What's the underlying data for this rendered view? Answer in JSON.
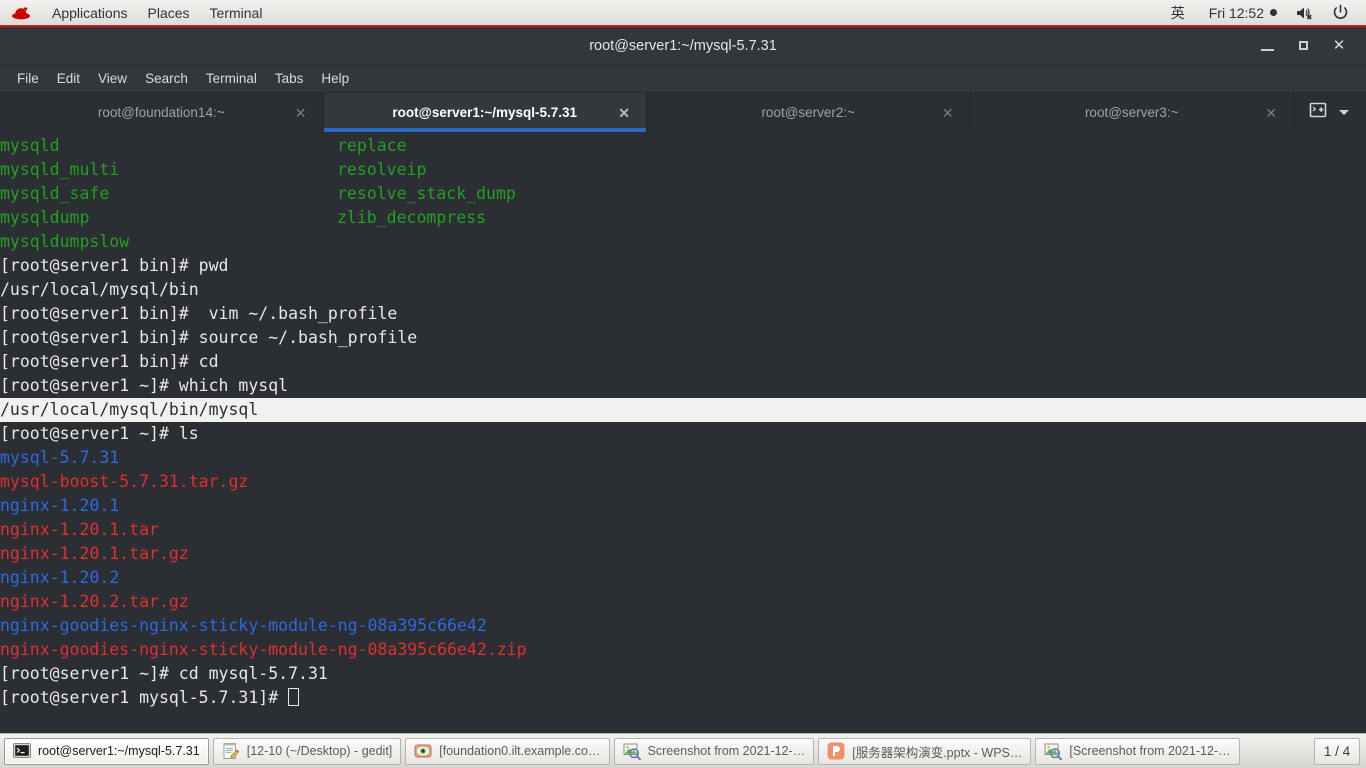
{
  "top_panel": {
    "logo_icon": "redhat-logo-icon",
    "menus": [
      {
        "label": "Applications"
      },
      {
        "label": "Places"
      },
      {
        "label": "Terminal"
      }
    ],
    "input_method": "英",
    "clock": "Fri 12:52",
    "volume_icon": "speaker-muted-icon",
    "power_icon": "power-icon"
  },
  "window": {
    "title": "root@server1:~/mysql-5.7.31",
    "controls": {
      "minimize": "minimize-icon",
      "maximize": "maximize-icon",
      "close": "✕"
    },
    "menu_bar": [
      {
        "label": "File"
      },
      {
        "label": "Edit"
      },
      {
        "label": "View"
      },
      {
        "label": "Search"
      },
      {
        "label": "Terminal"
      },
      {
        "label": "Tabs"
      },
      {
        "label": "Help"
      }
    ],
    "tabs": [
      {
        "label": "root@foundation14:~",
        "active": false,
        "close": "✕"
      },
      {
        "label": "root@server1:~/mysql-5.7.31",
        "active": true,
        "close": "✕"
      },
      {
        "label": "root@server2:~",
        "active": false,
        "close": "✕"
      },
      {
        "label": "root@server3:~",
        "active": false,
        "close": "✕"
      }
    ],
    "tab_actions": {
      "new_tab_icon": "new-terminal-tab-icon",
      "tab_list_icon": "chevron-down-icon"
    }
  },
  "terminal": {
    "columns": {
      "left": [
        "mysqld",
        "mysqld_multi",
        "mysqld_safe",
        "mysqldump",
        "mysqldumpslow"
      ],
      "right": [
        "replace",
        "resolveip",
        "resolve_stack_dump",
        "zlib_decompress",
        ""
      ]
    },
    "lines": [
      {
        "text": "[root@server1 bin]# pwd",
        "color": "white"
      },
      {
        "text": "/usr/local/mysql/bin",
        "color": "white"
      },
      {
        "text": "[root@server1 bin]#  vim ~/.bash_profile",
        "color": "white"
      },
      {
        "text": "[root@server1 bin]# source ~/.bash_profile",
        "color": "white"
      },
      {
        "text": "[root@server1 bin]# cd",
        "color": "white"
      },
      {
        "text": "[root@server1 ~]# which mysql",
        "color": "white"
      },
      {
        "text": "/usr/local/mysql/bin/mysql",
        "color": "white",
        "highlight": true
      },
      {
        "text": "[root@server1 ~]# ls",
        "color": "white"
      },
      {
        "text": "mysql-5.7.31",
        "color": "blue"
      },
      {
        "text": "mysql-boost-5.7.31.tar.gz",
        "color": "red"
      },
      {
        "text": "nginx-1.20.1",
        "color": "blue"
      },
      {
        "text": "nginx-1.20.1.tar",
        "color": "red"
      },
      {
        "text": "nginx-1.20.1.tar.gz",
        "color": "red"
      },
      {
        "text": "nginx-1.20.2",
        "color": "blue"
      },
      {
        "text": "nginx-1.20.2.tar.gz",
        "color": "red"
      },
      {
        "text": "nginx-goodies-nginx-sticky-module-ng-08a395c66e42",
        "color": "blue"
      },
      {
        "text": "nginx-goodies-nginx-sticky-module-ng-08a395c66e42.zip",
        "color": "red"
      },
      {
        "text": "[root@server1 ~]# cd mysql-5.7.31",
        "color": "white"
      },
      {
        "text": "[root@server1 mysql-5.7.31]# ",
        "color": "white",
        "cursor": true
      }
    ],
    "colors": {
      "background": "#2b2e33",
      "foreground": "#e8e8e8",
      "green": "#22a022",
      "blue": "#2a6ce0",
      "red": "#e03030",
      "selection_bg": "#f0f0ee"
    }
  },
  "taskbar": {
    "items": [
      {
        "label": "root@server1:~/mysql-5.7.31",
        "icon": "terminal-icon",
        "active": true
      },
      {
        "label": "[12-10 (~/Desktop) - gedit]",
        "icon": "gedit-icon",
        "active": false
      },
      {
        "label": "[foundation0.ilt.example.co…",
        "icon": "remote-viewer-icon",
        "active": false
      },
      {
        "label": "Screenshot from 2021-12-…",
        "icon": "image-viewer-icon",
        "active": false
      },
      {
        "label": "[服务器架构演变.pptx - WPS…",
        "icon": "wps-presentation-icon",
        "active": false
      },
      {
        "label": "[Screenshot from 2021-12-…",
        "icon": "image-viewer-icon",
        "active": false
      }
    ],
    "workspace": "1 / 4"
  }
}
